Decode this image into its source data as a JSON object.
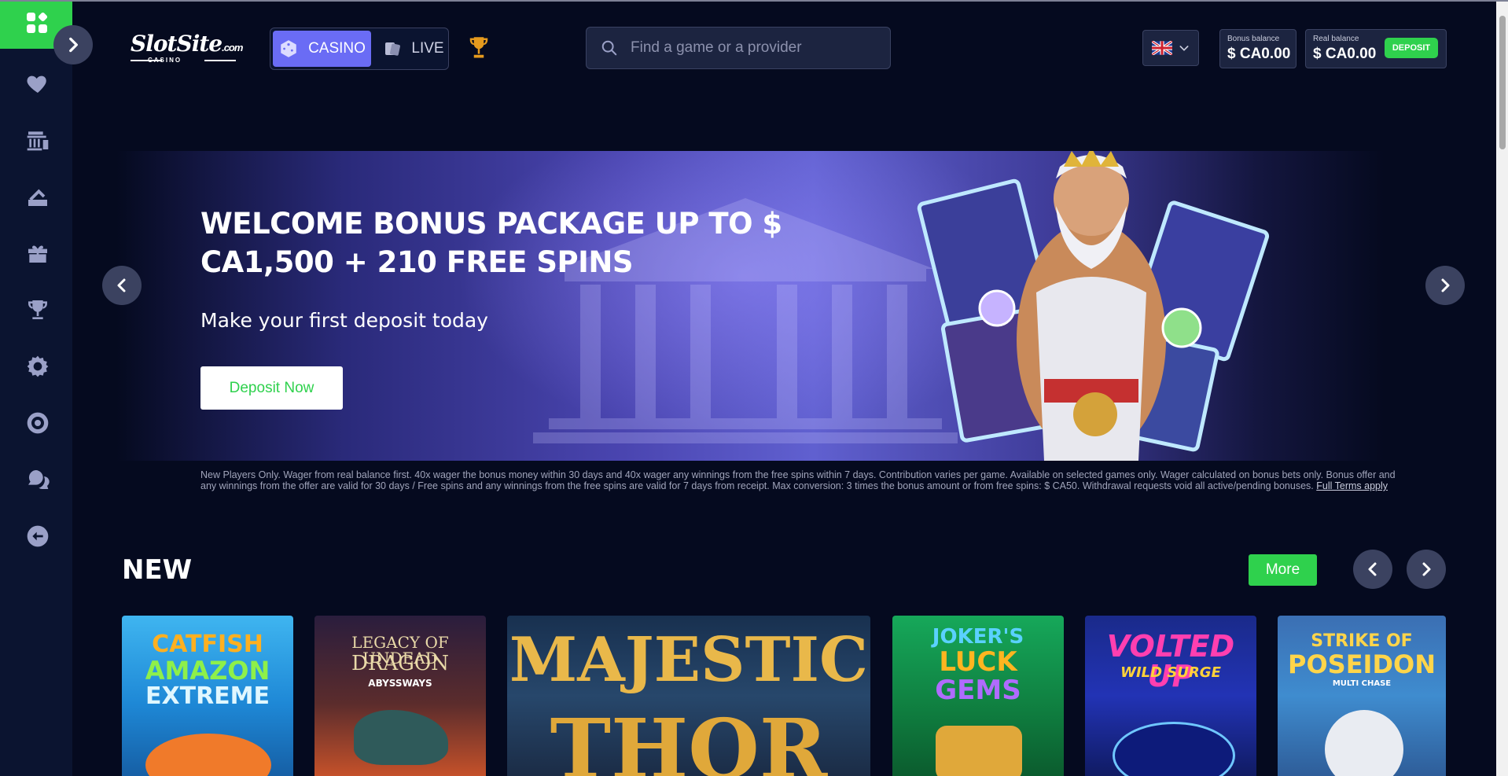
{
  "sidebar": {
    "items": [
      {
        "name": "favorites",
        "icon": "heart-icon"
      },
      {
        "name": "casino",
        "icon": "casino-building-icon"
      },
      {
        "name": "payments",
        "icon": "wallet-card-icon"
      },
      {
        "name": "promotions",
        "icon": "gift-icon"
      },
      {
        "name": "tournaments",
        "icon": "trophy-icon"
      },
      {
        "name": "settings",
        "icon": "gear-icon"
      },
      {
        "name": "responsible-gaming",
        "icon": "lifebuoy-icon"
      },
      {
        "name": "support",
        "icon": "help-chat-icon"
      },
      {
        "name": "logout",
        "icon": "logout-icon"
      }
    ]
  },
  "header": {
    "brand_name": "SlotSite",
    "brand_tld": ".com",
    "brand_sub": "CASINO",
    "mode_casino": "CASINO",
    "mode_live": "LIVE",
    "search_placeholder": "Find a game or a provider",
    "bonus_caption": "Bonus balance",
    "bonus_amount": "$ CA0.00",
    "real_caption": "Real balance",
    "real_amount": "$ CA0.00",
    "deposit_label": "DEPOSIT"
  },
  "banner": {
    "title": "WELCOME BONUS PACKAGE UP TO $ CA1,500 + 210 FREE SPINS",
    "subtitle": "Make your first deposit today",
    "cta": "Deposit Now",
    "terms": "New Players Only. Wager from real balance first. 40x wager the bonus money within 30 days and 40x wager any winnings from the free spins within 7 days. Contribution varies per game. Available on selected games only. Wager calculated on bonus bets only. Bonus offer and any winnings from the offer are valid for 30 days / Free spins and any winnings from the free spins are valid for 7 days from receipt. Max conversion: 3 times the bonus amount or from free spins: $ CA50. Withdrawal requests void all active/pending bonuses.",
    "terms_link": "Full Terms apply"
  },
  "new_section": {
    "title": "NEW",
    "more_label": "More",
    "games": [
      {
        "line1": "CATFISH",
        "line2": "AMAZON",
        "line3": "EXTREME"
      },
      {
        "line1": "LEGACY OF UNDEAD",
        "line2": "DRAGON",
        "line3": "ABYSSWAYS"
      },
      {
        "line1": "MAJESTIC",
        "line2": "THOR"
      },
      {
        "line1": "JOKER'S",
        "line2": "LUCK",
        "line3": "GEMS"
      },
      {
        "line1": "VOLTED UP",
        "line2": "WILD SURGE"
      },
      {
        "line1": "STRIKE OF",
        "line2": "POSEIDON",
        "line3": "MULTI CHASE"
      }
    ]
  },
  "colors": {
    "background": "#050a1f",
    "sidebar": "#0b1430",
    "accent_green": "#2fd14d",
    "accent_purple": "#6a6cf5",
    "icon_muted": "#9aa0c7"
  }
}
